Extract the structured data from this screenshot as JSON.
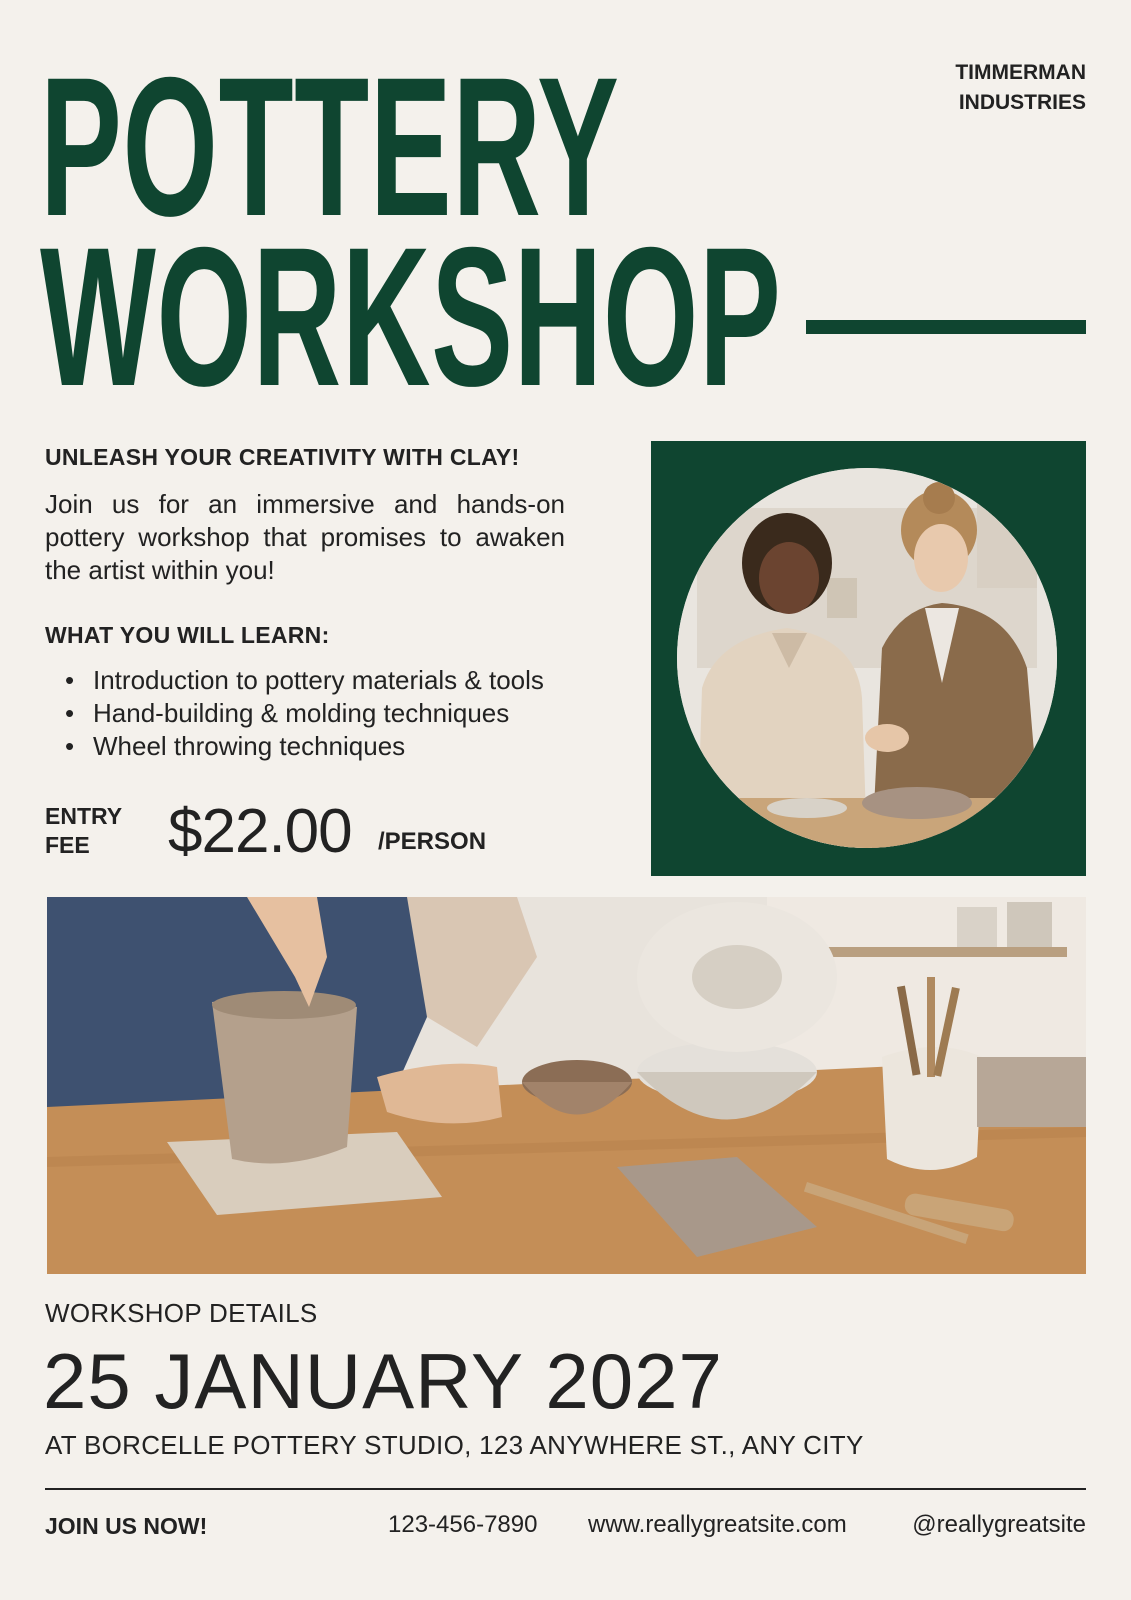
{
  "header": {
    "title_line1": "POTTERY",
    "title_line2": "WORKSHOP",
    "company_line1": "TIMMERMAN",
    "company_line2": "INDUSTRIES"
  },
  "intro": {
    "tagline": "UNLEASH YOUR CREATIVITY WITH CLAY!",
    "body": "Join us for an immersive and hands-on pottery workshop that promises to awaken the artist within you!"
  },
  "learn": {
    "heading": "WHAT YOU WILL LEARN:",
    "items": [
      "Introduction to pottery materials & tools",
      "Hand-building & molding techniques",
      "Wheel throwing techniques"
    ]
  },
  "fee": {
    "label_line1": "ENTRY",
    "label_line2": "FEE",
    "price": "$22.00",
    "unit": "/PERSON"
  },
  "details": {
    "label": "WORKSHOP DETAILS",
    "date": "25 JANUARY 2027",
    "venue": "AT BORCELLE POTTERY STUDIO, 123 ANYWHERE ST., ANY CITY"
  },
  "footer": {
    "cta": "JOIN US NOW!",
    "phone": "123-456-7890",
    "website": "www.reallygreatsite.com",
    "social": "@reallygreatsite"
  },
  "colors": {
    "accent": "#0f4530",
    "background": "#f4f1ec",
    "text": "#222222"
  }
}
